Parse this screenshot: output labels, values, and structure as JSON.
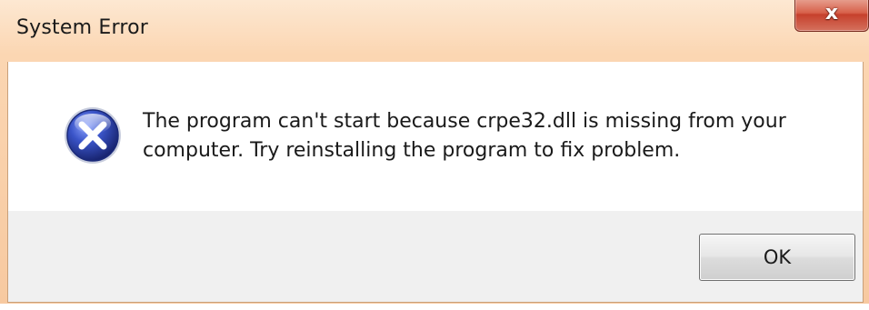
{
  "dialog": {
    "title": "System Error",
    "close_glyph": "x",
    "icon": "error-x-icon",
    "message": "The program can't start because crpe32.dll is missing from your computer. Try reinstalling the program to fix problem.",
    "ok_label": "OK"
  },
  "colors": {
    "frame": "#f7c9a0",
    "close_button": "#c6402c",
    "icon_blue": "#2b3f9e",
    "footer": "#f0f0f0"
  }
}
